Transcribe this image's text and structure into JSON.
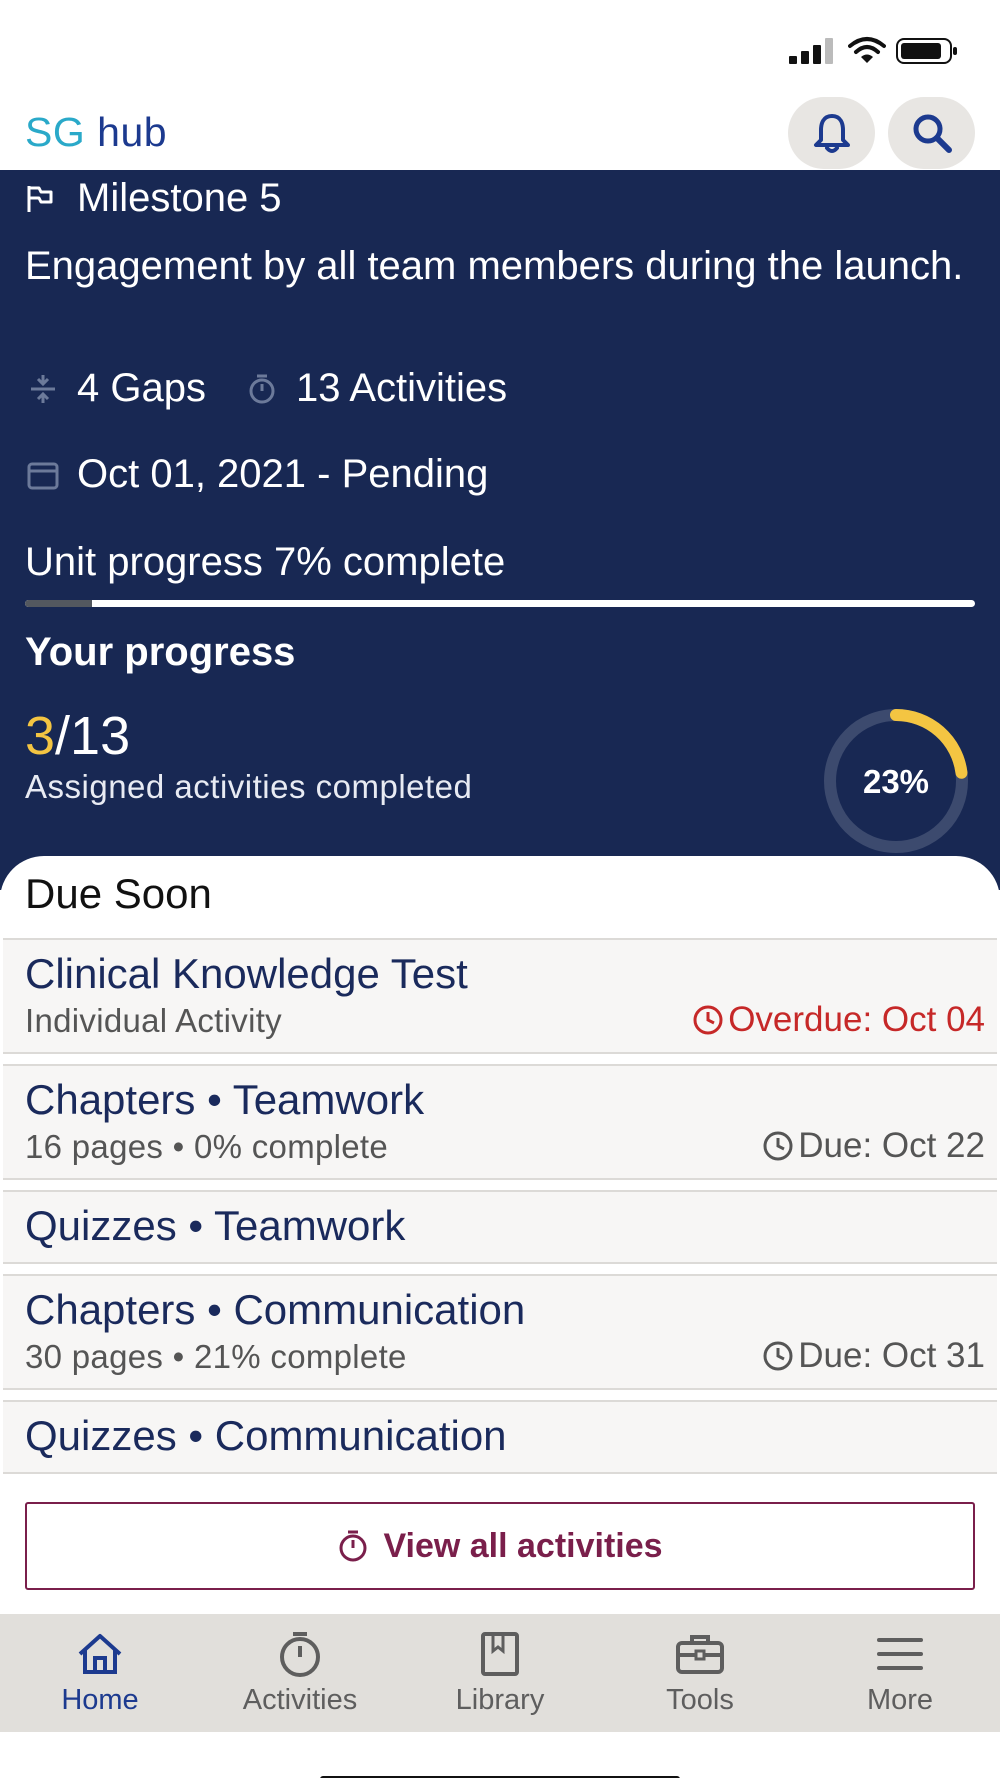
{
  "header": {
    "brand_sg": "SG",
    "brand_hub": "hub",
    "icons": [
      "bell-icon",
      "search-icon"
    ]
  },
  "milestone": {
    "title": "Milestone 5",
    "description": "Engagement by all team members during the launch.",
    "gaps": "4 Gaps",
    "activities": "13 Activities",
    "date_status": "Oct 01, 2021 - Pending",
    "unit_progress_label": "Unit progress 7% complete",
    "unit_progress_value": 0.07
  },
  "your_progress": {
    "title": "Your progress",
    "completed": "3",
    "total": "/13",
    "label": "Assigned activities completed",
    "percent_label": "23%",
    "percent_value": 0.23
  },
  "due_soon": {
    "title": "Due Soon",
    "items": [
      {
        "title": "Clinical Knowledge Test",
        "subtitle": "Individual Activity",
        "due": "Overdue: Oct 04",
        "overdue": true
      },
      {
        "title": "Chapters • Teamwork",
        "subtitle": "16 pages • 0% complete",
        "due": "Due: Oct 22",
        "overdue": false
      },
      {
        "title": "Quizzes • Teamwork",
        "subtitle": "",
        "due": "",
        "overdue": false
      },
      {
        "title": "Chapters • Communication",
        "subtitle": "30 pages • 21% complete",
        "due": "Due: Oct 31",
        "overdue": false
      },
      {
        "title": "Quizzes • Communication",
        "subtitle": "",
        "due": "",
        "overdue": false
      }
    ],
    "view_all_label": "View all activities"
  },
  "nav": {
    "items": [
      {
        "label": "Home",
        "icon": "home-icon",
        "active": true
      },
      {
        "label": "Activities",
        "icon": "stopwatch-icon",
        "active": false
      },
      {
        "label": "Library",
        "icon": "book-icon",
        "active": false
      },
      {
        "label": "Tools",
        "icon": "toolbox-icon",
        "active": false
      },
      {
        "label": "More",
        "icon": "menu-icon",
        "active": false
      }
    ]
  },
  "colors": {
    "panel_bg": "#182853",
    "accent_yellow": "#f4c542",
    "overdue_red": "#c62828",
    "primary_blue": "#1c3a8f",
    "maroon": "#7a1f4b"
  }
}
